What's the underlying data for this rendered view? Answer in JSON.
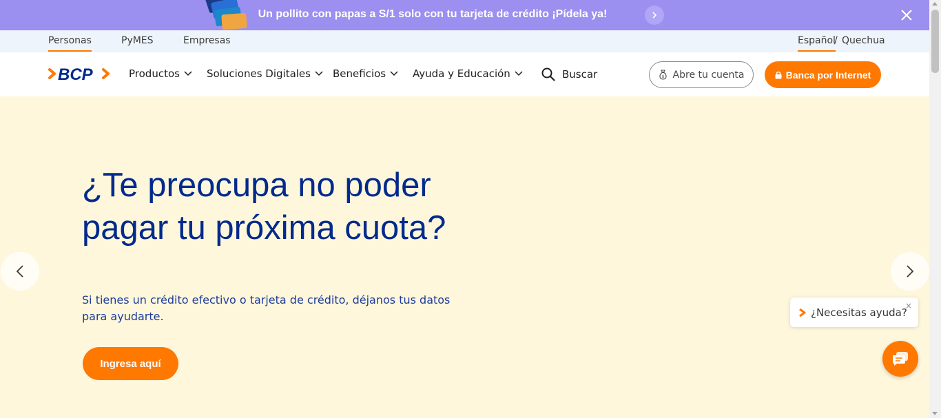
{
  "promo": {
    "text": "Un pollito con papas a S/1 solo con tu tarjeta de crédito ¡Pídela ya!",
    "cards_icon": "credit-cards-icon",
    "next_icon": "chevron-right-icon",
    "close_icon": "close-icon",
    "bg_color": "#9b8ff0"
  },
  "segments": {
    "items": [
      "Personas",
      "PyMES",
      "Empresas"
    ],
    "active": "Personas"
  },
  "language": {
    "active": "Español",
    "separator": "/",
    "other": "Quechua"
  },
  "nav": {
    "logo_text": "BCP",
    "menu": [
      "Productos",
      "Soluciones Digitales",
      "Beneficios",
      "Ayuda y Educación"
    ],
    "search_label": "Buscar",
    "open_account_label": "Abre tu cuenta",
    "online_banking_label": "Banca por Internet",
    "accent_color": "#ff7800",
    "brand_color": "#002a8d"
  },
  "hero": {
    "title": "¿Te preocupa no poder pagar tu próxima cuota?",
    "subtitle": "Si tienes un crédito efectivo o tarjeta de crédito, déjanos tus datos para ayudarte.",
    "cta_label": "Ingresa aquí",
    "prev_icon": "chevron-left-icon",
    "next_icon": "chevron-right-icon",
    "bg_color": "#fef7dc"
  },
  "help": {
    "bubble_text": "¿Necesitas ayuda?",
    "close_glyph": "×",
    "fab_icon": "chat-icon"
  }
}
